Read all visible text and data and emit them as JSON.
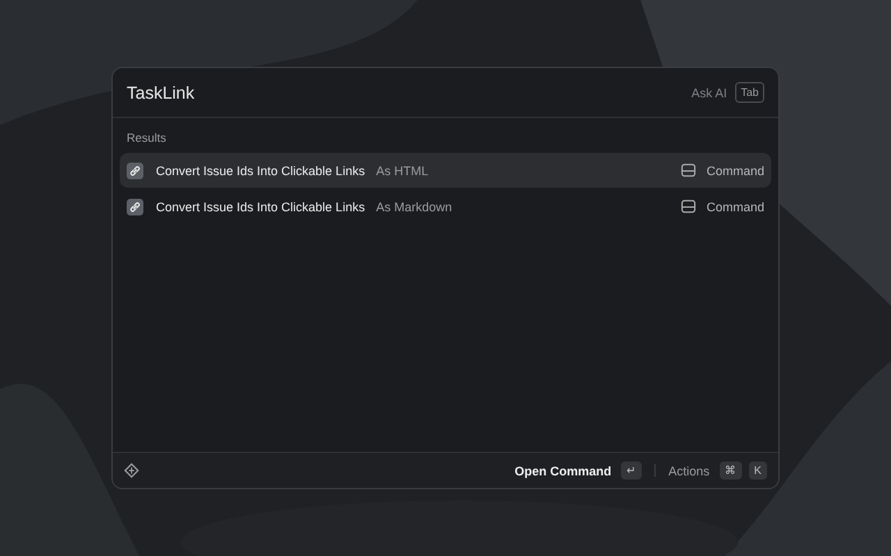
{
  "search": {
    "value": "TaskLink"
  },
  "ask_ai": {
    "label": "Ask AI",
    "key": "Tab"
  },
  "section_title": "Results",
  "results": [
    {
      "title": "Convert Issue Ids Into Clickable Links",
      "subtitle": "As HTML",
      "type": "Command",
      "selected": true
    },
    {
      "title": "Convert Issue Ids Into Clickable Links",
      "subtitle": "As Markdown",
      "type": "Command",
      "selected": false
    }
  ],
  "footer": {
    "primary_action": "Open Command",
    "primary_key": "↵",
    "actions_label": "Actions",
    "action_keys": [
      "⌘",
      "K"
    ]
  }
}
